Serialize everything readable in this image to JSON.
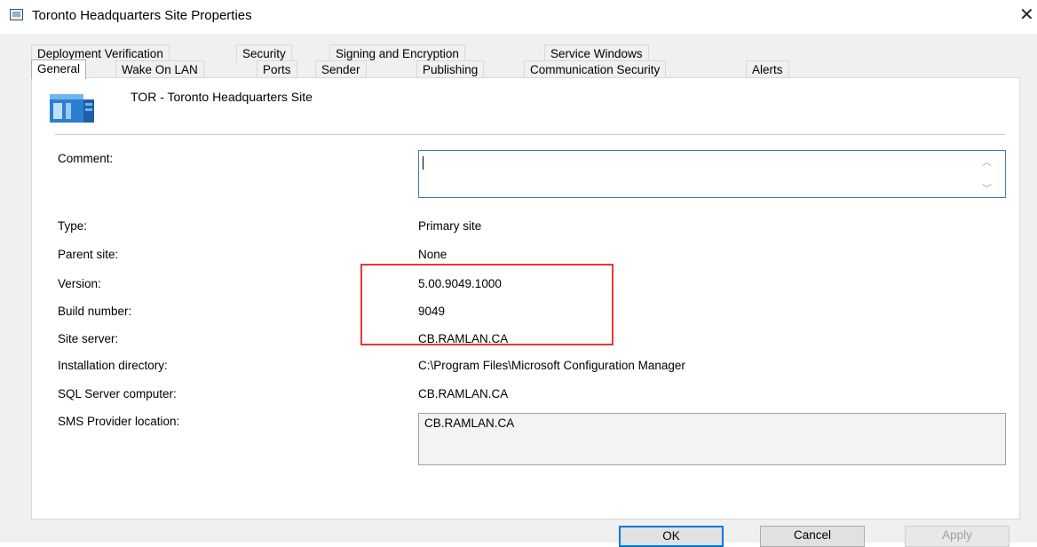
{
  "window": {
    "title": "Toronto Headquarters Site Properties",
    "close_glyph": "✕"
  },
  "tabs_row1": [
    {
      "label": "Deployment Verification"
    },
    {
      "label": "Security"
    },
    {
      "label": "Signing and Encryption"
    },
    {
      "label": "Service Windows"
    }
  ],
  "tabs_row2": [
    {
      "label": "General",
      "active": true
    },
    {
      "label": "Wake On LAN"
    },
    {
      "label": "Ports"
    },
    {
      "label": "Sender"
    },
    {
      "label": "Publishing"
    },
    {
      "label": "Communication Security"
    },
    {
      "label": "Alerts"
    }
  ],
  "general": {
    "site_name": "TOR - Toronto Headquarters Site",
    "site_icon": "server-site-icon",
    "comment_label": "Comment:",
    "comment_value": "",
    "fields": [
      {
        "label": "Type:",
        "value": "Primary site"
      },
      {
        "label": "Parent site:",
        "value": "None"
      },
      {
        "label": "Version:",
        "value": "5.00.9049.1000"
      },
      {
        "label": "Build number:",
        "value": "9049"
      },
      {
        "label": "Site server:",
        "value": "CB.RAMLAN.CA"
      },
      {
        "label": "Installation directory:",
        "value": "C:\\Program Files\\Microsoft Configuration Manager"
      },
      {
        "label": "SQL Server computer:",
        "value": "CB.RAMLAN.CA"
      }
    ],
    "sms_provider_label": "SMS Provider location:",
    "sms_provider_value": "CB.RAMLAN.CA"
  },
  "buttons": {
    "ok": "OK",
    "cancel": "Cancel",
    "apply": "Apply"
  },
  "colors": {
    "highlight": "#e53935",
    "focus_border": "#0078d7",
    "disabled_text": "#a0a0a0"
  }
}
